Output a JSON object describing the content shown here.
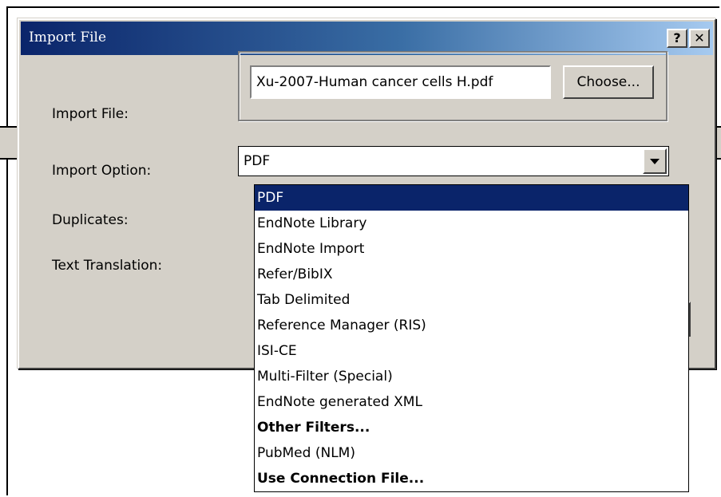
{
  "dialog": {
    "title": "Import File",
    "help_button": "?",
    "close_button": "✕"
  },
  "form": {
    "import_file_label": "Import File:",
    "import_file_value": "Xu-2007-Human cancer cells H.pdf",
    "choose_button": "Choose...",
    "import_option_label": "Import Option:",
    "import_option_value": "PDF",
    "duplicates_label": "Duplicates:",
    "text_translation_label": "Text Translation:"
  },
  "dropdown": {
    "items": [
      {
        "label": "PDF",
        "selected": true,
        "bold": false
      },
      {
        "label": "EndNote Library",
        "selected": false,
        "bold": false
      },
      {
        "label": "EndNote Import",
        "selected": false,
        "bold": false
      },
      {
        "label": "Refer/BibIX",
        "selected": false,
        "bold": false
      },
      {
        "label": "Tab Delimited",
        "selected": false,
        "bold": false
      },
      {
        "label": "Reference Manager (RIS)",
        "selected": false,
        "bold": false
      },
      {
        "label": "ISI-CE",
        "selected": false,
        "bold": false
      },
      {
        "label": "Multi-Filter (Special)",
        "selected": false,
        "bold": false
      },
      {
        "label": "EndNote generated XML",
        "selected": false,
        "bold": false
      },
      {
        "label": "Other Filters...",
        "selected": false,
        "bold": true
      },
      {
        "label": "PubMed (NLM)",
        "selected": false,
        "bold": false
      },
      {
        "label": "Use Connection File...",
        "selected": false,
        "bold": true
      }
    ]
  },
  "colors": {
    "titlebar_start": "#0a246a",
    "titlebar_end": "#a6caf0",
    "dialog_face": "#d4d0c8",
    "selection": "#0a246a"
  }
}
